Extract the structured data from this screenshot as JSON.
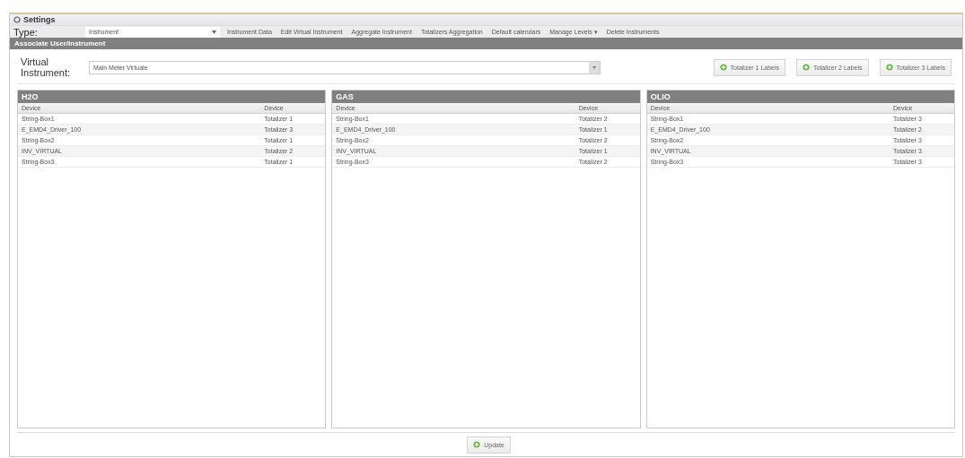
{
  "window": {
    "title": "Settings"
  },
  "toolbar": {
    "type_label": "Type:",
    "type_value": "Instrument",
    "items": [
      "Instrument Data",
      "Edit Virtual Instrument",
      "Aggregate Instrument",
      "Totalizers Aggregation",
      "Default calendars",
      "Manage Levels ▾",
      "Delete Instruments"
    ]
  },
  "section": {
    "title": "Associate User/Instrument"
  },
  "virtual_instrument": {
    "label": "Virtual Instrument:",
    "value": "Main Meter Virtuale"
  },
  "label_buttons": [
    "Totalizer 1 Labels",
    "Totalizer 2 Labels",
    "Totalizer 3 Labels"
  ],
  "panels": [
    {
      "title": "H2O",
      "columns": [
        "Device",
        "Device"
      ],
      "rows": [
        [
          "String-Box1",
          "Totalizer 1"
        ],
        [
          "E_EMD4_Driver_100",
          "Totalizer 3"
        ],
        [
          "String-Box2",
          "Totalizer 1"
        ],
        [
          "INV_VIRTUAL",
          "Totalizer 2"
        ],
        [
          "String-Box3",
          "Totalizer 1"
        ]
      ]
    },
    {
      "title": "GAS",
      "columns": [
        "Device",
        "Device"
      ],
      "rows": [
        [
          "String-Box1",
          "Totalizer 2"
        ],
        [
          "E_EMD4_Driver_100",
          "Totalizer 1"
        ],
        [
          "String-Box2",
          "Totalizer 2"
        ],
        [
          "INV_VIRTUAL",
          "Totalizer 1"
        ],
        [
          "String-Box3",
          "Totalizer 2"
        ]
      ]
    },
    {
      "title": "OLIO",
      "columns": [
        "Device",
        "Device"
      ],
      "rows": [
        [
          "String-Box1",
          "Totalizer 3"
        ],
        [
          "E_EMD4_Driver_100",
          "Totalizer 2"
        ],
        [
          "String-Box2",
          "Totalizer 3"
        ],
        [
          "INV_VIRTUAL",
          "Totalizer 3"
        ],
        [
          "String-Box3",
          "Totalizer 3"
        ]
      ]
    }
  ],
  "update_button": "Update"
}
